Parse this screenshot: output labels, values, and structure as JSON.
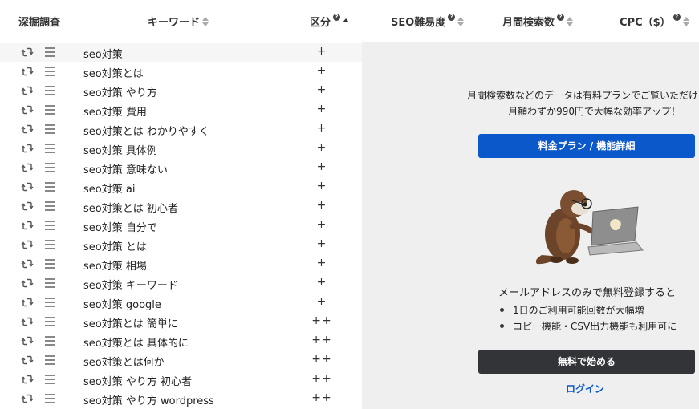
{
  "header": {
    "col_dig": "深掘調査",
    "col_keyword": "キーワード",
    "col_category": "区分",
    "col_seo": "SEO難易度",
    "col_volume": "月間検索数",
    "col_cpc": "CPC（$）",
    "help_glyph": "?"
  },
  "rows": [
    {
      "keyword": "seo対策",
      "category": "+"
    },
    {
      "keyword": "seo対策とは",
      "category": "+"
    },
    {
      "keyword": "seo対策 やり方",
      "category": "+"
    },
    {
      "keyword": "seo対策 費用",
      "category": "+"
    },
    {
      "keyword": "seo対策とは わかりやすく",
      "category": "+"
    },
    {
      "keyword": "seo対策 具体例",
      "category": "+"
    },
    {
      "keyword": "seo対策 意味ない",
      "category": "+"
    },
    {
      "keyword": "seo対策 ai",
      "category": "+"
    },
    {
      "keyword": "seo対策とは 初心者",
      "category": "+"
    },
    {
      "keyword": "seo対策 自分で",
      "category": "+"
    },
    {
      "keyword": "seo対策 とは",
      "category": "+"
    },
    {
      "keyword": "seo対策 相場",
      "category": "+"
    },
    {
      "keyword": "seo対策 キーワード",
      "category": "+"
    },
    {
      "keyword": "seo対策 google",
      "category": "+"
    },
    {
      "keyword": "seo対策とは 簡単に",
      "category": "++"
    },
    {
      "keyword": "seo対策とは 具体的に",
      "category": "++"
    },
    {
      "keyword": "seo対策とは何か",
      "category": "++"
    },
    {
      "keyword": "seo対策 やり方 初心者",
      "category": "++"
    },
    {
      "keyword": "seo対策 やり方 wordpress",
      "category": "++"
    }
  ],
  "panel": {
    "promo_line1": "月間検索数などのデータは有料プランでご覧いただけ",
    "promo_line2": "月額わずか990円で大幅な効率アップ！",
    "plan_button": "料金プラン / 機能詳細",
    "signup_text": "メールアドレスのみで無料登録すると",
    "bullets": [
      "1日のご利用可能回数が大幅増",
      "コピー機能・CSV出力機能も利用可に"
    ],
    "start_button": "無料で始める",
    "login_link": "ログイン"
  },
  "colors": {
    "accent_blue": "#0a58ca",
    "dark_button": "#333438",
    "panel_bg": "#efefef"
  },
  "icons": [
    "repeat-icon",
    "menu-lines-icon",
    "help-icon",
    "sort-icon",
    "sort-asc-icon",
    "mascot-otter-laptop"
  ]
}
